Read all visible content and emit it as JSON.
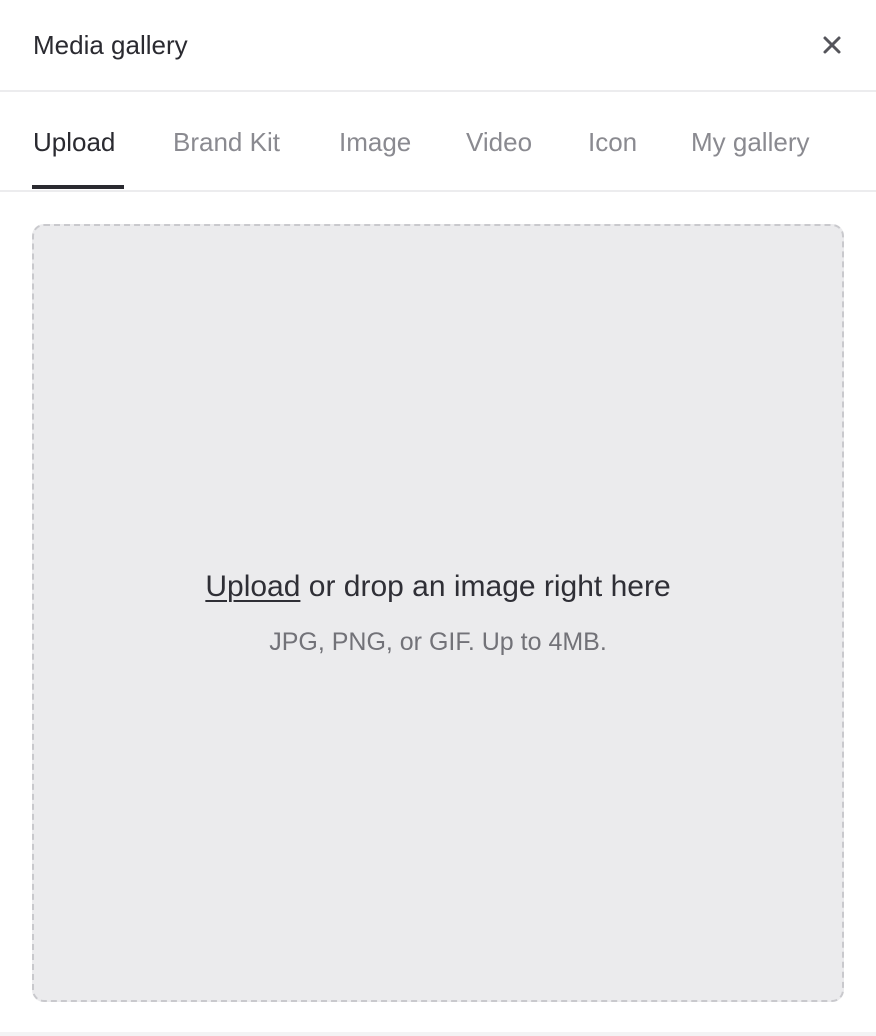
{
  "header": {
    "title": "Media gallery",
    "close_icon": "close-icon"
  },
  "tabs": [
    {
      "label": "Upload",
      "active": true
    },
    {
      "label": "Brand Kit",
      "active": false
    },
    {
      "label": "Image",
      "active": false
    },
    {
      "label": "Video",
      "active": false
    },
    {
      "label": "Icon",
      "active": false
    },
    {
      "label": "My gallery",
      "active": false
    }
  ],
  "dropzone": {
    "upload_link": "Upload",
    "main_text": " or drop an image right here",
    "hint": "JPG, PNG, or GIF. Up to 4MB."
  },
  "colors": {
    "text_primary": "#2a2a30",
    "text_muted": "#8a8a90",
    "dropzone_bg": "#ebebed",
    "dropzone_border": "#c9c9cd"
  }
}
